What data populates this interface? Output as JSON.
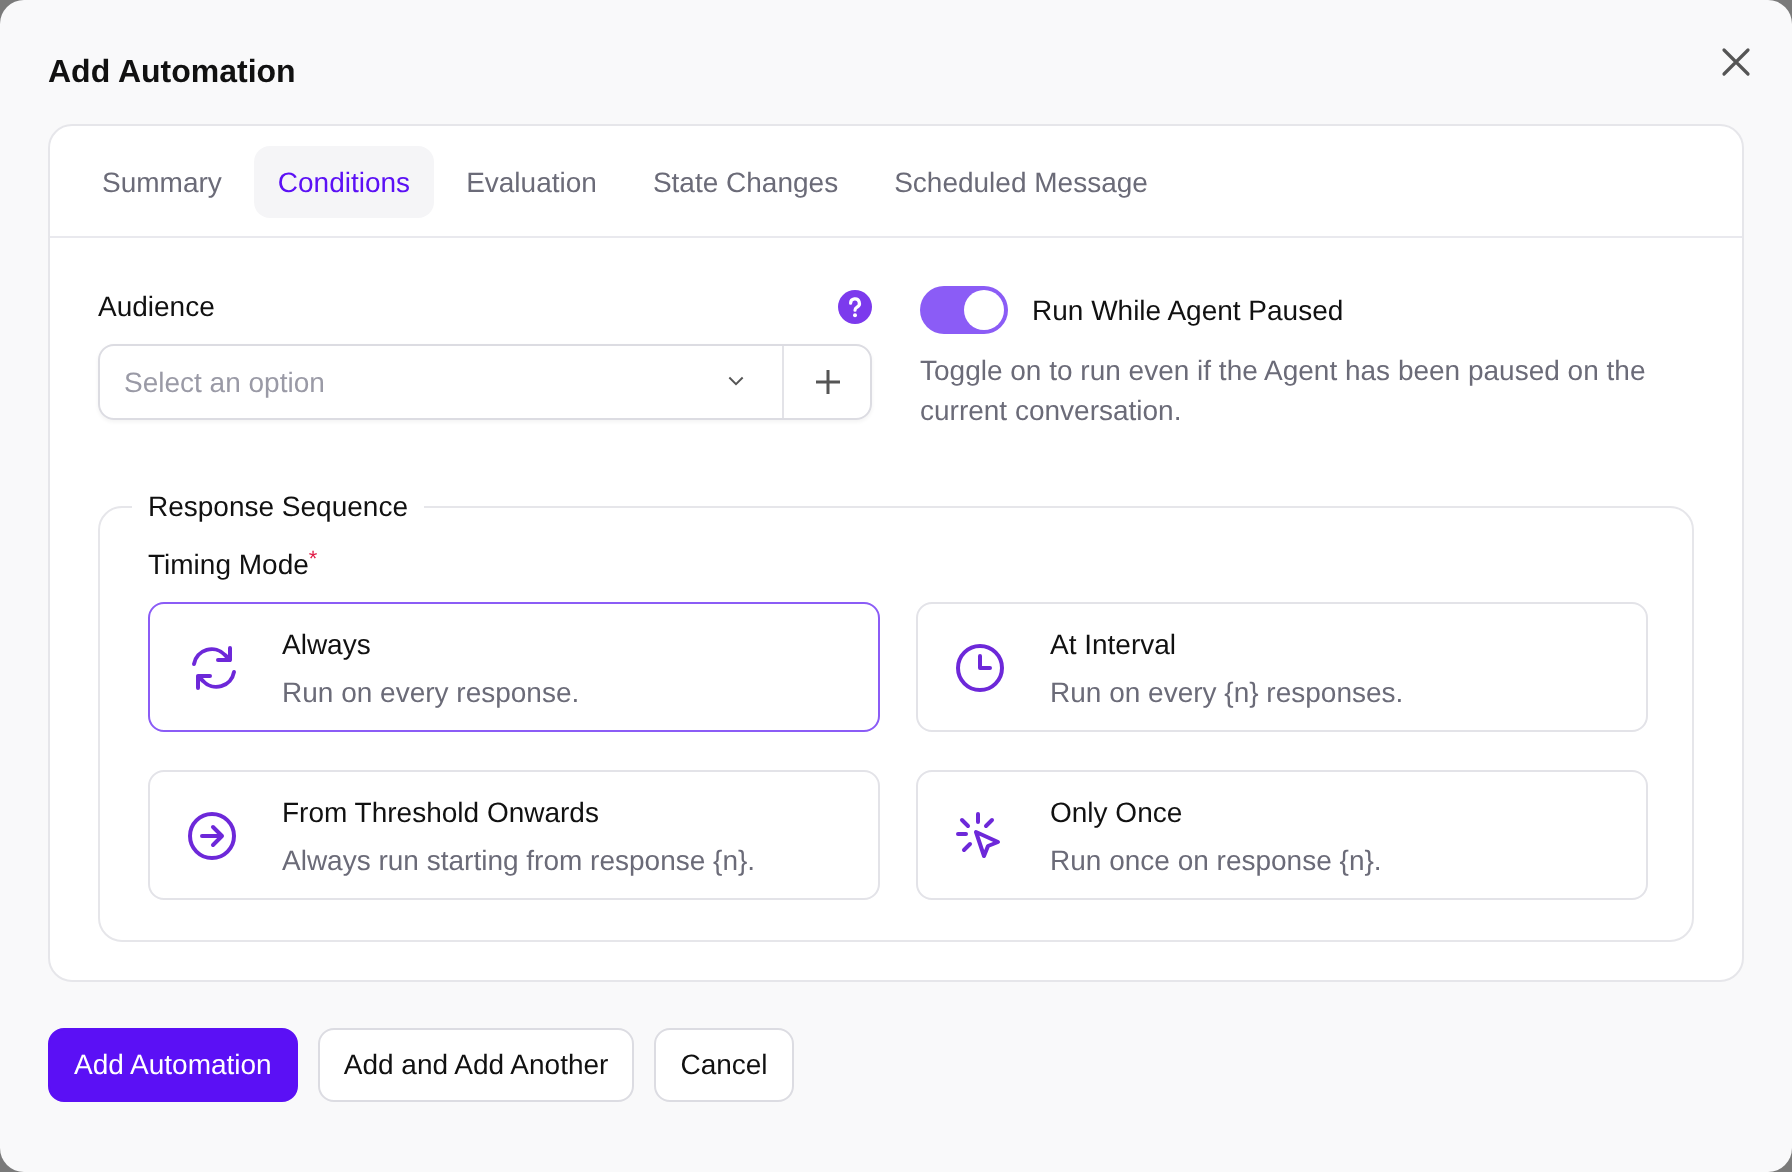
{
  "dialog": {
    "title": "Add Automation"
  },
  "tabs": [
    {
      "label": "Summary",
      "selected": false
    },
    {
      "label": "Conditions",
      "selected": true
    },
    {
      "label": "Evaluation",
      "selected": false
    },
    {
      "label": "State Changes",
      "selected": false
    },
    {
      "label": "Scheduled Message",
      "selected": false
    }
  ],
  "audience": {
    "label": "Audience",
    "placeholder": "Select an option"
  },
  "pause_toggle": {
    "label": "Run While Agent Paused",
    "on": true,
    "help": "Toggle on to run even if the Agent has been paused on the current conversation."
  },
  "response_sequence": {
    "legend": "Response Sequence",
    "timing_label": "Timing Mode",
    "required_mark": "*",
    "options": [
      {
        "kind": "refresh",
        "title": "Always",
        "description": "Run on every response.",
        "selected": true
      },
      {
        "kind": "clock",
        "title": "At Interval",
        "description": "Run on every {n} responses.",
        "selected": false
      },
      {
        "kind": "arrow",
        "title": "From Threshold Onwards",
        "description": "Always run starting from response {n}.",
        "selected": false
      },
      {
        "kind": "click",
        "title": "Only Once",
        "description": "Run once on response {n}.",
        "selected": false
      }
    ]
  },
  "buttons": [
    {
      "label": "Add Automation",
      "kind": "primary"
    },
    {
      "label": "Add and Add Another",
      "kind": "secondary"
    },
    {
      "label": "Cancel",
      "kind": "secondary"
    }
  ]
}
